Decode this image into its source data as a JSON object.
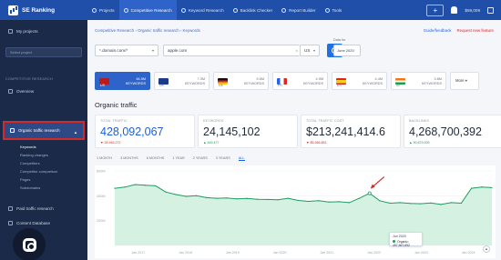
{
  "app": {
    "logo_text": "SE Ranking",
    "nav": [
      "Projects",
      "Competitive Research",
      "Keyword Research",
      "Backlink Checker",
      "Report Builder",
      "Tools"
    ],
    "price": "$59,009"
  },
  "sidebar": {
    "items": [
      "My projects"
    ],
    "select_placeholder": "Select project",
    "section_label": "COMPETITIVE RESEARCH",
    "overview": "Overview",
    "active_item": "Organic traffic research",
    "sub_items": [
      "Keywords",
      "Ranking changes",
      "Competitors",
      "Competitor comparison",
      "Pages",
      "Subdomains"
    ],
    "lower_items": [
      "Paid traffic research",
      "Content Database"
    ]
  },
  "main": {
    "breadcrumb": "Competitive Research › Organic traffic research › Keywords",
    "header_links": [
      "Guide/feedback",
      "Request new feature"
    ],
    "domain_select": "*.domain.com/*",
    "query": "apple.com",
    "region": "US",
    "date_label": "Data for",
    "date_value": "June 2020",
    "db_tabs": [
      {
        "code": "US",
        "count_top": "84.5M",
        "count_bottom": "KEYWORDS",
        "color": "#b91c1c",
        "active": true
      },
      {
        "code": "UK",
        "count_top": "7.3M",
        "count_bottom": "KEYWORDS",
        "color": "#1e3a8a",
        "active": false
      },
      {
        "code": "DE",
        "count_top": "5.6M",
        "count_bottom": "KEYWORDS",
        "color": "#374151",
        "active": false
      },
      {
        "code": "FR",
        "count_top": "4.9M",
        "count_bottom": "KEYWORDS",
        "color": "#2563eb",
        "active": false
      },
      {
        "code": "ES",
        "count_top": "4.4M",
        "count_bottom": "KEYWORDS",
        "color": "#dc2626",
        "active": false
      },
      {
        "code": "IN",
        "count_top": "3.8M",
        "count_bottom": "KEYWORDS",
        "color": "#16a34a",
        "active": false
      }
    ],
    "more_label": "More",
    "section_title": "Organic traffic",
    "kpis": [
      {
        "label": "TOTAL TRAFFIC",
        "value": "428,092,067",
        "delta": "▼ 28,945,272",
        "trend": "neg"
      },
      {
        "label": "KEYWORDS",
        "value": "24,145,102",
        "delta": "▲ 449,477",
        "trend": "pos"
      },
      {
        "label": "TOTAL TRAFFIC COST",
        "value": "$213,241,414.6",
        "delta": "▼ $5,366,851",
        "trend": "neg"
      },
      {
        "label": "BACKLINKS",
        "value": "4,268,700,392",
        "delta": "▲ 90,679,005",
        "trend": "pos"
      }
    ],
    "range_tabs": [
      "1 MONTH",
      "3 MONTHS",
      "6 MONTHS",
      "1 YEAR",
      "2 YEARS",
      "3 YEARS",
      "ALL"
    ],
    "active_range": 6,
    "tooltip_date": "Jun 2020",
    "tooltip_value": "Organic: 497,567,692"
  },
  "chart_data": {
    "type": "area",
    "x": [
      "Jan 2017",
      "Jan 2018",
      "Jan 2019",
      "Jan 2020",
      "Jan 2021",
      "Jan 2022",
      "Jan 2023",
      "Jan 2024"
    ],
    "series": [
      {
        "values": [
          460,
          470,
          490,
          485,
          480,
          430,
          410,
          395,
          400,
          385,
          380,
          382,
          375,
          378,
          372,
          370,
          368,
          380,
          362,
          355,
          360,
          350,
          352,
          345,
          380,
          420,
          360,
          340,
          345,
          338,
          336,
          342,
          330,
          345,
          340,
          460,
          470,
          465
        ]
      }
    ],
    "ytick_labels": [
      "600M",
      "400M",
      "200M"
    ],
    "accent": "#1e9b62"
  }
}
